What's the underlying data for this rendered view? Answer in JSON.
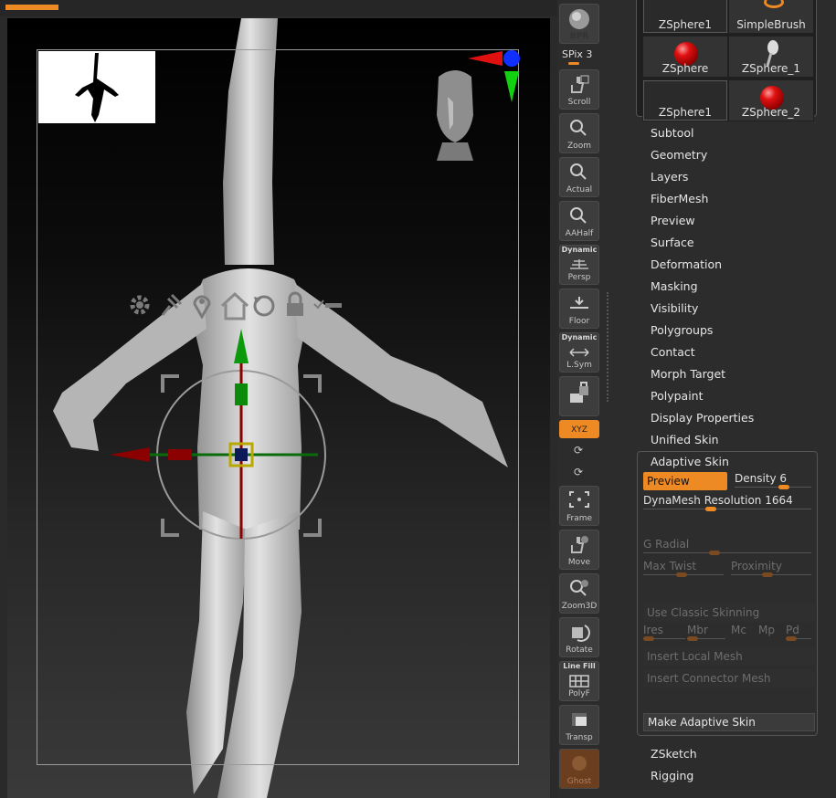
{
  "toolbar": {
    "bpr": "BPR",
    "spix": "SPix 3",
    "scroll": "Scroll",
    "zoom": "Zoom",
    "actual": "Actual",
    "aahalf": "AAHalf",
    "dynamic": "Dynamic",
    "persp": "Persp",
    "floor": "Floor",
    "lsym": "L.Sym",
    "xyz": "XYZ",
    "frame": "Frame",
    "move": "Move",
    "zoom3d": "Zoom3D",
    "rotate": "Rotate",
    "line_fill": "Line Fill",
    "polyf": "PolyF",
    "transp": "Transp",
    "ghost": "Ghost"
  },
  "materials": [
    {
      "label": "ZSphere1"
    },
    {
      "label": "SimpleBrush"
    },
    {
      "label": "ZSphere"
    },
    {
      "label": "ZSphere_1"
    },
    {
      "label": "ZSphere1"
    },
    {
      "label": "ZSphere_2"
    }
  ],
  "menu": [
    "Subtool",
    "Geometry",
    "Layers",
    "FiberMesh",
    "Preview",
    "Surface",
    "Deformation",
    "Masking",
    "Visibility",
    "Polygroups",
    "Contact",
    "Morph Target",
    "Polypaint",
    "Display Properties",
    "Unified Skin"
  ],
  "adaptive_skin": {
    "title": "Adaptive Skin",
    "preview": "Preview",
    "density": "Density 6",
    "dynamesh": "DynaMesh Resolution 1664",
    "g_radial": "G Radial",
    "max_twist": "Max Twist",
    "proximity": "Proximity",
    "classic": "Use Classic Skinning",
    "ires": "Ires",
    "mbr": "Mbr",
    "mc": "Mc",
    "mp": "Mp",
    "pd": "Pd",
    "insert_local": "Insert Local Mesh",
    "insert_connector": "Insert Connector Mesh",
    "make": "Make Adaptive Skin"
  },
  "menu_bottom": [
    "ZSketch",
    "Rigging"
  ],
  "colors": {
    "accent": "#ee8a24"
  }
}
